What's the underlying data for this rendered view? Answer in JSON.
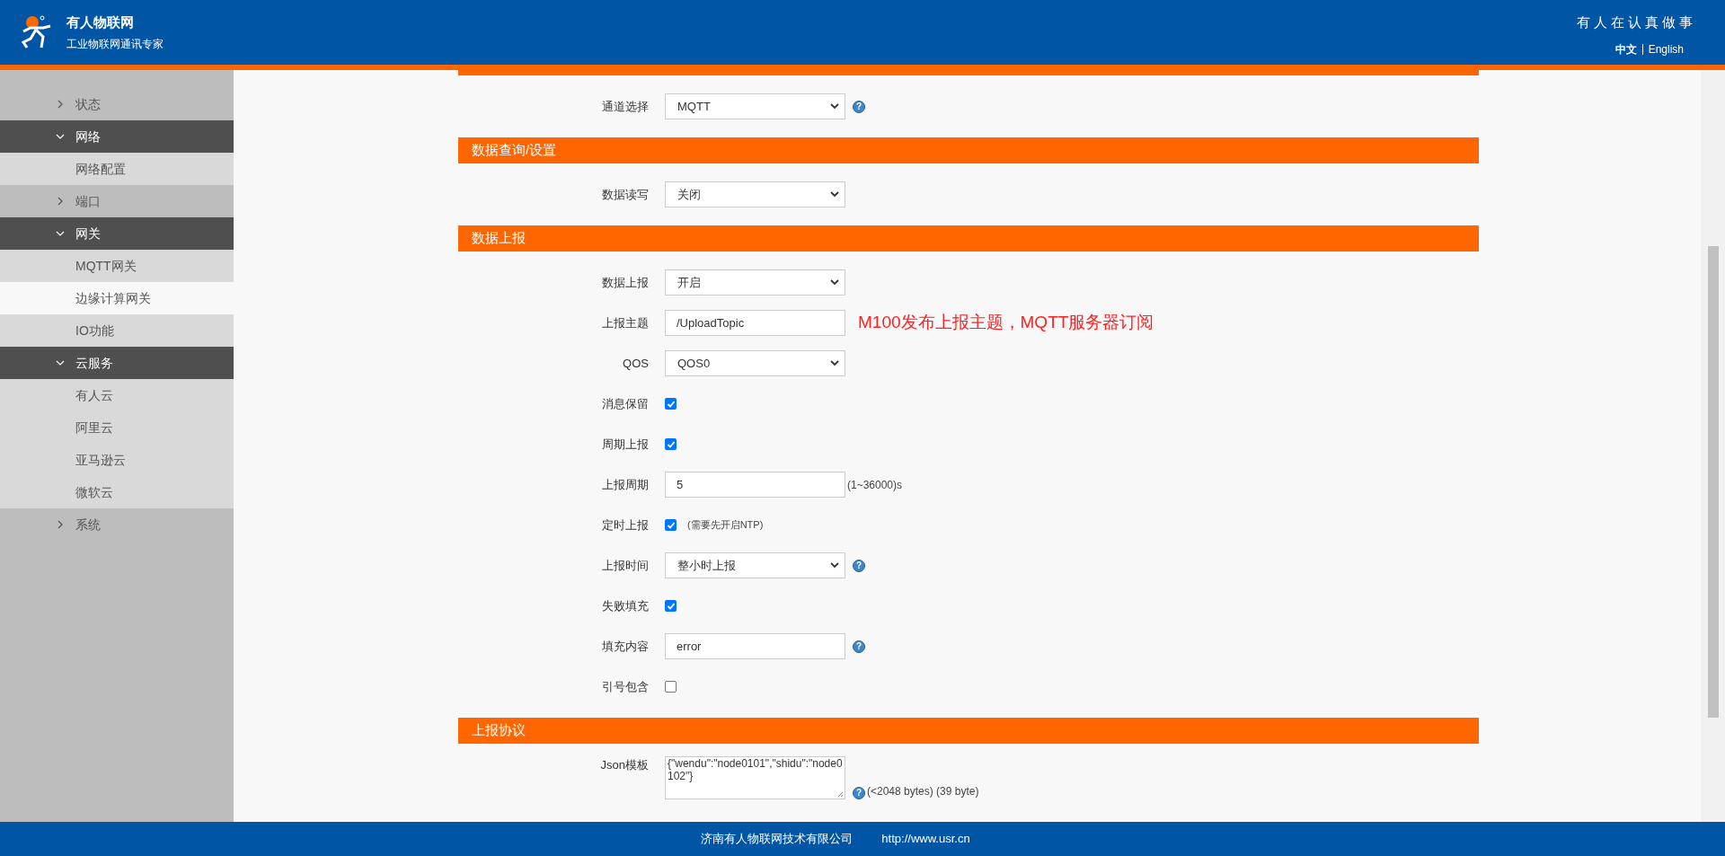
{
  "header": {
    "brand": "有人物联网",
    "tagline": "工业物联网通讯专家",
    "slogan": "有人在认真做事",
    "languages": [
      {
        "label": "中文",
        "selected": true
      },
      {
        "label": "English",
        "selected": false
      }
    ]
  },
  "sidebar": [
    {
      "label": "状态",
      "expanded": false
    },
    {
      "label": "网络",
      "expanded": true,
      "children": [
        {
          "label": "网络配置",
          "selected": false
        }
      ]
    },
    {
      "label": "端口",
      "expanded": false
    },
    {
      "label": "网关",
      "expanded": true,
      "children": [
        {
          "label": "MQTT网关",
          "selected": false
        },
        {
          "label": "边缘计算网关",
          "selected": true
        },
        {
          "label": "IO功能",
          "selected": false
        }
      ]
    },
    {
      "label": "云服务",
      "expanded": true,
      "children": [
        {
          "label": "有人云",
          "selected": false
        },
        {
          "label": "阿里云",
          "selected": false
        },
        {
          "label": "亚马逊云",
          "selected": false
        },
        {
          "label": "微软云",
          "selected": false
        }
      ]
    },
    {
      "label": "系统",
      "expanded": false
    }
  ],
  "sections": [
    {
      "fields": [
        {
          "label": "通道选择",
          "kind": "select",
          "value": "MQTT",
          "help": "?"
        }
      ]
    },
    {
      "title": "数据查询/设置",
      "fields": [
        {
          "label": "数据读写",
          "kind": "select",
          "value": "关闭"
        }
      ]
    },
    {
      "title": "数据上报",
      "fields": [
        {
          "label": "数据上报",
          "kind": "select",
          "value": "开启"
        },
        {
          "label": "上报主题",
          "kind": "text",
          "value": "/UploadTopic",
          "annotation": "M100发布上报主题，MQTT服务器订阅"
        },
        {
          "label": "QOS",
          "kind": "select",
          "value": "QOS0"
        },
        {
          "label": "消息保留",
          "kind": "checkbox",
          "checked": true
        },
        {
          "label": "周期上报",
          "kind": "checkbox",
          "checked": true
        },
        {
          "label": "上报周期",
          "kind": "text",
          "value": "5",
          "note": "(1~36000)s"
        },
        {
          "label": "定时上报",
          "kind": "checkbox",
          "checked": true,
          "note": "(需要先开启NTP)"
        },
        {
          "label": "上报时间",
          "kind": "select",
          "value": "整小时上报",
          "help": "?"
        },
        {
          "label": "失败填充",
          "kind": "checkbox",
          "checked": true
        },
        {
          "label": "填充内容",
          "kind": "text",
          "value": "error",
          "help": "?"
        },
        {
          "label": "引号包含",
          "kind": "checkbox",
          "checked": false
        }
      ]
    },
    {
      "title": "上报协议",
      "fields": [
        {
          "label": "Json模板",
          "kind": "textarea",
          "value": "{\"wendu\":\"node0101\",\"shidu\":\"node0102\"}",
          "help": "?",
          "note": "(<2048 bytes) (39 byte)"
        }
      ]
    }
  ],
  "footer": {
    "company": "济南有人物联网技术有限公司",
    "url": "http://www.usr.cn"
  }
}
